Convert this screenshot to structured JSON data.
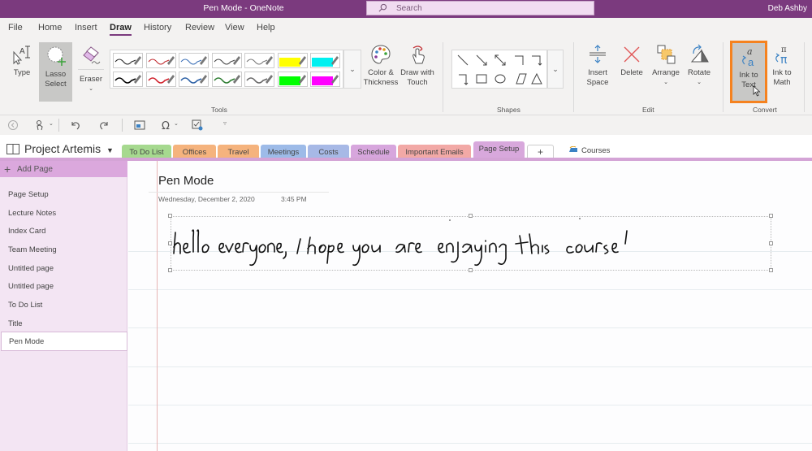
{
  "titlebar": {
    "title": "Pen Mode  -  OneNote",
    "search_placeholder": "Search",
    "user": "Deb Ashby"
  },
  "menu": {
    "items": [
      {
        "label": "File"
      },
      {
        "label": "Home"
      },
      {
        "label": "Insert"
      },
      {
        "label": "Draw",
        "active": true
      },
      {
        "label": "History"
      },
      {
        "label": "Review"
      },
      {
        "label": "View"
      },
      {
        "label": "Help"
      }
    ]
  },
  "ribbon": {
    "tools": {
      "type_label": "Type",
      "lasso_label": "Lasso Select",
      "lasso_line1": "Lasso",
      "lasso_line2": "Select",
      "eraser_label": "Eraser",
      "group_label": "Tools",
      "pens": [
        {
          "color": "#222222",
          "kind": "pen"
        },
        {
          "color": "#c0282d",
          "kind": "pen"
        },
        {
          "color": "#3b6fb6",
          "kind": "pen"
        },
        {
          "color": "#444444",
          "kind": "pen"
        },
        {
          "color": "#777777",
          "kind": "pen"
        },
        {
          "color": "#ffff00",
          "kind": "highlighter"
        },
        {
          "color": "#00f0f0",
          "kind": "highlighter"
        },
        {
          "color": "#000000",
          "kind": "pen"
        },
        {
          "color": "#d0202a",
          "kind": "pen"
        },
        {
          "color": "#2a5fa5",
          "kind": "pen"
        },
        {
          "color": "#2e7d32",
          "kind": "pen"
        },
        {
          "color": "#666666",
          "kind": "pen"
        },
        {
          "color": "#00ff00",
          "kind": "highlighter"
        },
        {
          "color": "#ff00ff",
          "kind": "highlighter"
        }
      ]
    },
    "color_thickness": {
      "line1": "Color &",
      "line2": "Thickness"
    },
    "draw_touch": {
      "line1": "Draw with",
      "line2": "Touch"
    },
    "shapes": {
      "group_label": "Shapes",
      "items": [
        "line",
        "arrow",
        "double-arrow",
        "elbow",
        "elbow-arrow",
        "elbow-arrow-left",
        "rectangle",
        "ellipse",
        "parallelogram",
        "triangle"
      ]
    },
    "edit": {
      "group_label": "Edit",
      "insert_space": {
        "line1": "Insert",
        "line2": "Space"
      },
      "delete": "Delete",
      "arrange": "Arrange",
      "rotate": "Rotate"
    },
    "convert": {
      "group_label": "Convert",
      "ink_to_text": {
        "line1": "Ink to",
        "line2": "Text"
      },
      "ink_to_math": {
        "line1": "Ink to",
        "line2": "Math"
      },
      "highlight_color": "#f5821f"
    }
  },
  "notebook": {
    "name": "Project Artemis",
    "sections": [
      {
        "label": "To Do List",
        "color": "#a6d98f"
      },
      {
        "label": "Offices",
        "color": "#f5b37d"
      },
      {
        "label": "Travel",
        "color": "#f5b37d"
      },
      {
        "label": "Meetings",
        "color": "#9dbbe8"
      },
      {
        "label": "Costs",
        "color": "#a7b9e6"
      },
      {
        "label": "Schedule",
        "color": "#d7a6dd"
      },
      {
        "label": "Important Emails",
        "color": "#f2a9a6"
      },
      {
        "label": "Page Setup",
        "color": "#d8a8dc",
        "active": true
      }
    ],
    "add_section": "+",
    "section_group": "Courses"
  },
  "pages": {
    "add_label": "Add Page",
    "items": [
      {
        "label": "Page Setup"
      },
      {
        "label": "Lecture Notes"
      },
      {
        "label": "Index Card"
      },
      {
        "label": "Team Meeting"
      },
      {
        "label": "Untitled page"
      },
      {
        "label": "Untitled page"
      },
      {
        "label": "To Do List"
      },
      {
        "label": "Title"
      },
      {
        "label": "Pen Mode",
        "selected": true
      }
    ]
  },
  "page": {
    "title": "Pen Mode",
    "date": "Wednesday, December 2, 2020",
    "time": "3:45 PM",
    "ink_text": "hello everyone, I hope you are enjoying this course!"
  },
  "colors": {
    "accent": "#7b3a7e",
    "page_list_bg": "#f3e5f3",
    "highlight": "#f5821f"
  }
}
